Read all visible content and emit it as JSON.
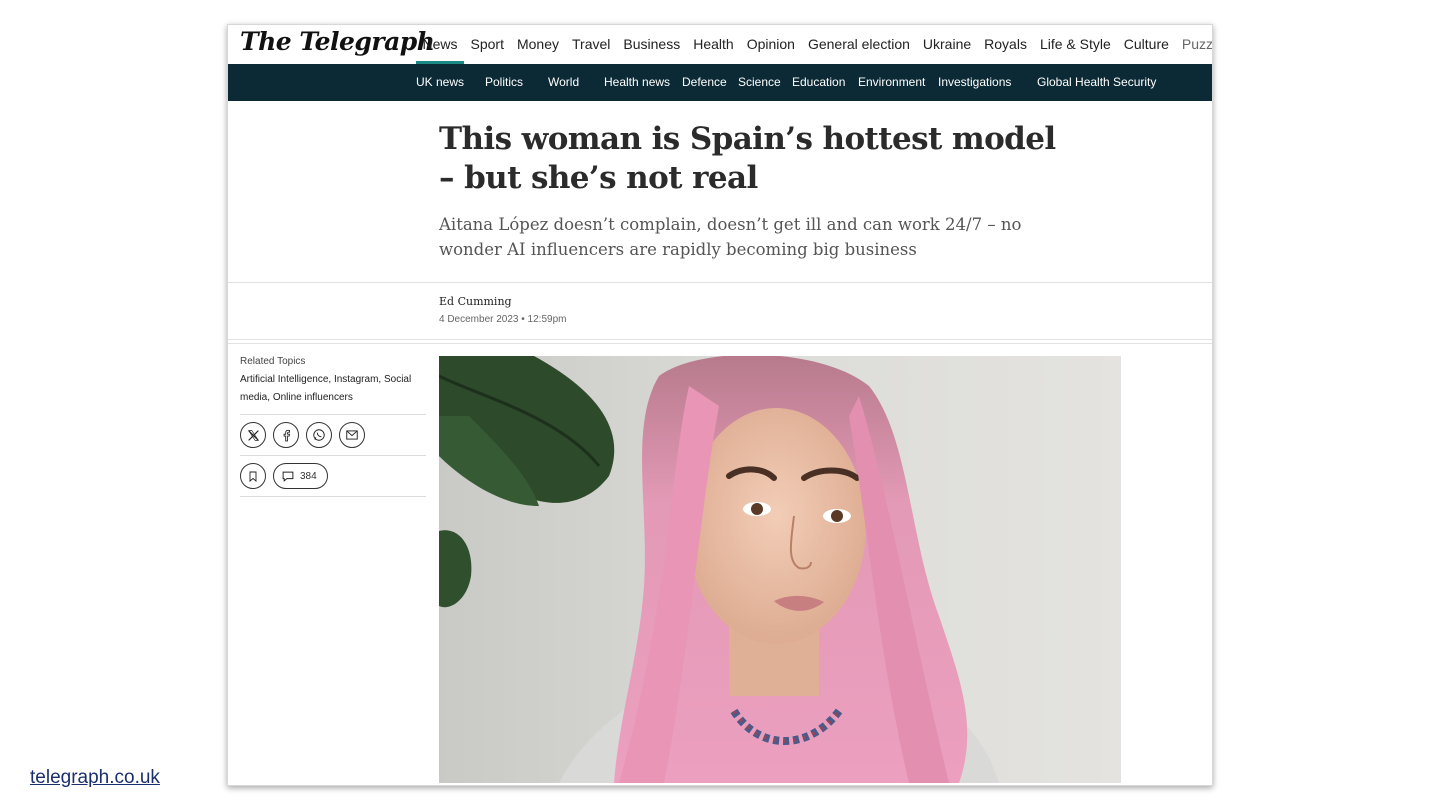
{
  "site": {
    "logo": "The Telegraph",
    "source_link": "telegraph.co.uk"
  },
  "main_nav": [
    {
      "label": "News",
      "active": true
    },
    {
      "label": "Sport"
    },
    {
      "label": "Money"
    },
    {
      "label": "Travel"
    },
    {
      "label": "Business"
    },
    {
      "label": "Health"
    },
    {
      "label": "Opinion"
    },
    {
      "label": "General election"
    },
    {
      "label": "Ukraine"
    },
    {
      "label": "Royals"
    },
    {
      "label": "Life & Style"
    },
    {
      "label": "Culture"
    },
    {
      "label": "Puzzles"
    }
  ],
  "sub_nav": [
    {
      "label": "UK news"
    },
    {
      "label": "Politics"
    },
    {
      "label": "World"
    },
    {
      "label": "Health news"
    },
    {
      "label": "Defence"
    },
    {
      "label": "Science"
    },
    {
      "label": "Education"
    },
    {
      "label": "Environment"
    },
    {
      "label": "Investigations"
    },
    {
      "label": "Global Health Security"
    }
  ],
  "article": {
    "headline": "This woman is Spain’s hottest model – but she’s not real",
    "standfirst": "Aitana López doesn’t complain, doesn’t get ill and can work 24/7 – no wonder AI influencers are rapidly becoming big business",
    "author": "Ed Cumming",
    "date": "4 December 2023 • 12:59pm"
  },
  "sidebar": {
    "related_heading": "Related Topics",
    "related_topics": [
      "Artificial Intelligence",
      "Instagram",
      "Social media",
      "Online influencers"
    ],
    "share_icons": [
      "x-icon",
      "facebook-icon",
      "whatsapp-icon",
      "email-icon"
    ],
    "comment_count": "384"
  },
  "colors": {
    "nav_dark": "#0b2a36",
    "nav_active": "#1b8a86",
    "link": "#1a2f6e"
  }
}
